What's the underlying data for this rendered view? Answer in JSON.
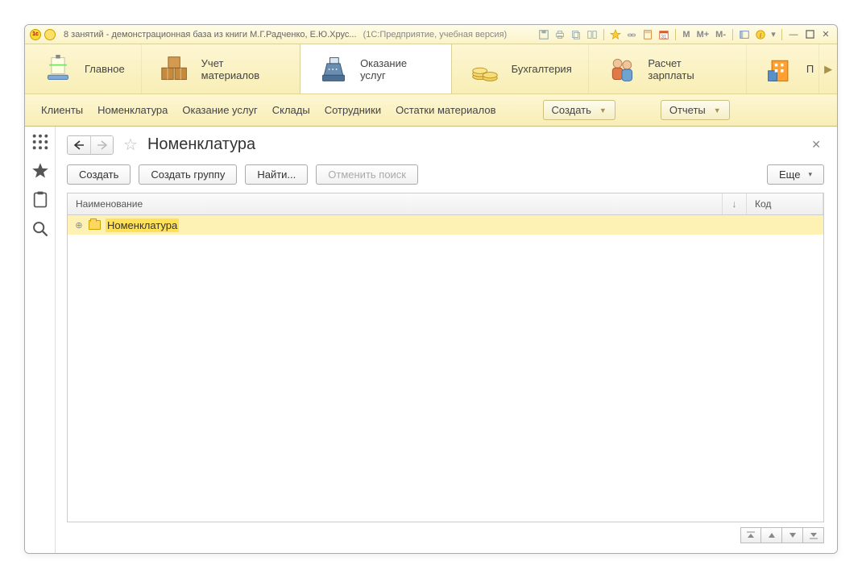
{
  "titlebar": {
    "title": "8 занятий - демонстрационная база из книги М.Г.Радченко, Е.Ю.Хрус...",
    "suffix": "(1С:Предприятие, учебная версия)",
    "mem_buttons": [
      "M",
      "M+",
      "M-"
    ]
  },
  "sections": [
    {
      "label": "Главное",
      "icon": "scanner"
    },
    {
      "label": "Учет материалов",
      "icon": "boxes"
    },
    {
      "label": "Оказание услуг",
      "icon": "register",
      "active": true
    },
    {
      "label": "Бухгалтерия",
      "icon": "coins"
    },
    {
      "label": "Расчет зарплаты",
      "icon": "people"
    },
    {
      "label": "П",
      "icon": "building"
    }
  ],
  "subnav": {
    "links": [
      "Клиенты",
      "Номенклатура",
      "Оказание услуг",
      "Склады",
      "Сотрудники",
      "Остатки материалов"
    ],
    "create_btn": "Создать",
    "reports_btn": "Отчеты"
  },
  "page": {
    "title": "Номенклатура",
    "buttons": {
      "create": "Создать",
      "create_group": "Создать группу",
      "find": "Найти...",
      "cancel_find": "Отменить поиск",
      "more": "Еще"
    },
    "columns": {
      "name": "Наименование",
      "code": "Код"
    },
    "rows": [
      {
        "name": "Номенклатура",
        "code": "",
        "selected": true,
        "highlighted": true
      }
    ]
  }
}
